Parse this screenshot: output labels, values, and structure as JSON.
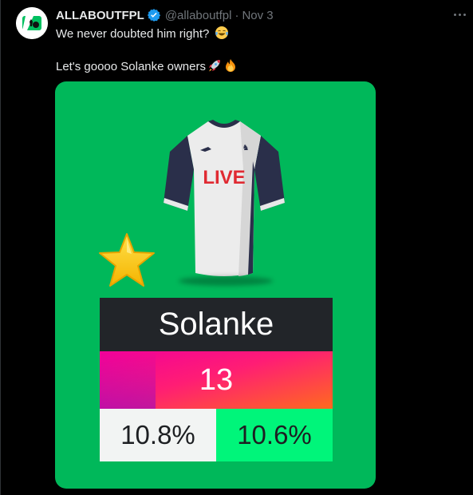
{
  "tweet": {
    "display_name": "ALLABOUTFPL",
    "verified": true,
    "handle": "@allaboutfpl",
    "separator": "·",
    "date": "Nov 3",
    "more_icon": "more-horizontal-icon",
    "text_line1": "We never doubted him right?",
    "text_line1_emoji": "face-with-tears-of-joy",
    "text_line2": "Let's goooo Solanke owners",
    "text_line2_emojis": [
      "rocket",
      "fire"
    ]
  },
  "card": {
    "background": "#00b85a",
    "shirt_label": "LIVE",
    "player_name": "Solanke",
    "points": "13",
    "stat_left": "10.8%",
    "stat_right": "10.6%",
    "captain_icon": "star-icon"
  },
  "colors": {
    "verified_blue": "#1d9bf0",
    "secondary_text": "#71767b",
    "name_bar": "#222529",
    "stat_right_bg": "#00f57a"
  }
}
